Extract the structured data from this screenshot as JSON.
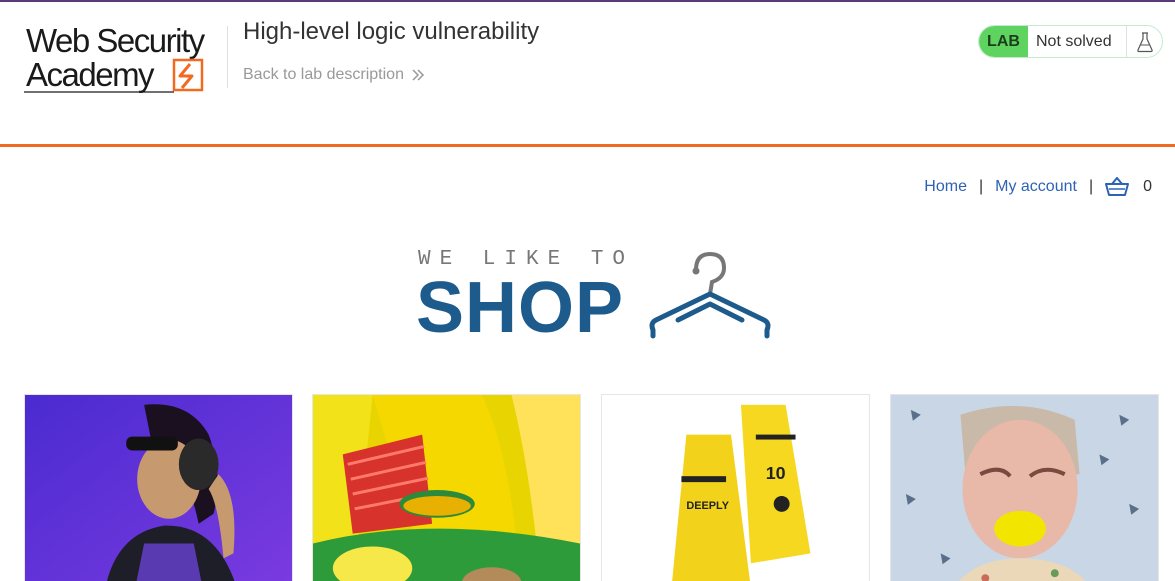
{
  "header": {
    "logo_text_line1": "Web Security",
    "logo_text_line2": "Academy",
    "lab_title": "High-level logic vulnerability",
    "back_link": "Back to lab description",
    "lab_badge": "LAB",
    "lab_status": "Not solved"
  },
  "nav": {
    "home": "Home",
    "separator": "|",
    "my_account": "My account",
    "cart_count": "0"
  },
  "banner": {
    "line1": "WE LIKE TO",
    "line2": "SHOP"
  },
  "colors": {
    "accent_orange": "#f26a21",
    "link_blue": "#2e62b5",
    "lab_green": "#5fd35f",
    "shop_blue": "#1c5b8c"
  },
  "products": [
    {
      "image": "woman-with-headphones-photo"
    },
    {
      "image": "inflatable-bouncy-castle-photo"
    },
    {
      "image": "yellow-caution-signs-photo"
    },
    {
      "image": "man-biting-lemon-photo"
    }
  ]
}
